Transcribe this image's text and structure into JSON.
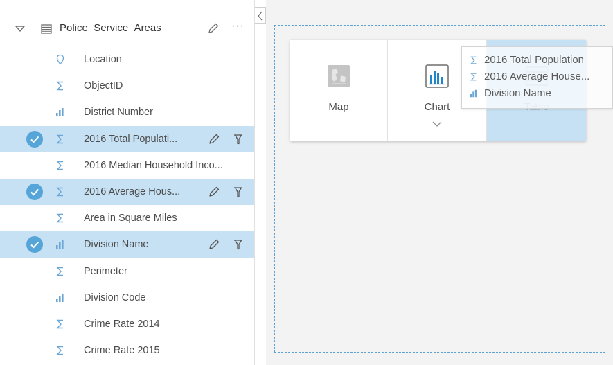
{
  "colors": {
    "selected_row": "#c6e1f3",
    "check_circle": "#56a5d8",
    "accent": "#1e86c9",
    "canvas_bg": "#f3f3f3",
    "drop_zone_border": "#5ba3d6"
  },
  "dataset": {
    "name": "Police_Service_Areas",
    "expand_icon": "triangle-down-icon",
    "table_icon": "table-icon",
    "edit_icon": "pencil-icon",
    "more_label": "···"
  },
  "fields": [
    {
      "name": "Location",
      "type_icon": "location-icon",
      "selected": false
    },
    {
      "name": "ObjectID",
      "type_icon": "sigma-icon",
      "selected": false
    },
    {
      "name": "District Number",
      "type_icon": "string-field-icon",
      "selected": false
    },
    {
      "name": "2016 Total Populati...",
      "type_icon": "sigma-icon",
      "selected": true
    },
    {
      "name": "2016 Median Household Inco...",
      "type_icon": "sigma-icon",
      "selected": false
    },
    {
      "name": "2016 Average Hous...",
      "type_icon": "sigma-icon",
      "selected": true
    },
    {
      "name": "Area in Square Miles",
      "type_icon": "sigma-icon",
      "selected": false
    },
    {
      "name": "Division Name",
      "type_icon": "string-field-icon",
      "selected": true
    },
    {
      "name": "Perimeter",
      "type_icon": "sigma-icon",
      "selected": false
    },
    {
      "name": "Division Code",
      "type_icon": "string-field-icon",
      "selected": false
    },
    {
      "name": "Crime Rate 2014",
      "type_icon": "sigma-icon",
      "selected": false
    },
    {
      "name": "Crime Rate 2015",
      "type_icon": "sigma-icon",
      "selected": false
    }
  ],
  "picker": {
    "map_label": "Map",
    "chart_label": "Chart",
    "table_label": "Table",
    "map_icon": "map-icon",
    "chart_icon": "bar-chart-icon",
    "table_icon": "table-icon",
    "chevron_icon": "chevron-down-icon"
  },
  "drag_tooltip": {
    "items": [
      {
        "label": "2016 Total Population",
        "icon": "sigma-icon"
      },
      {
        "label": "2016 Average House...",
        "icon": "sigma-icon"
      },
      {
        "label": "Division Name",
        "icon": "string-field-icon"
      }
    ]
  }
}
